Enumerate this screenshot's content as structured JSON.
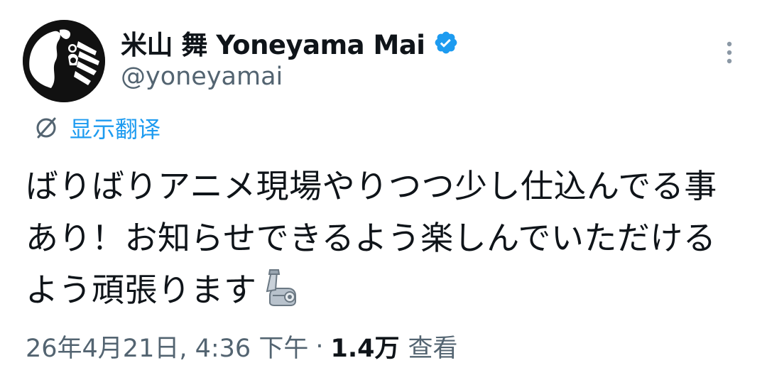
{
  "author": {
    "display_name": "米山 舞 Yoneyama Mai",
    "handle": "@yoneyamai",
    "verified": true,
    "verified_color": "#1d9bf0",
    "avatar_icon": "avatar-illustration"
  },
  "translate": {
    "label": "显示翻译",
    "icon": "translate-icon",
    "color": "#1d9bf0"
  },
  "tweet": {
    "text": "ばりばりアニメ現場やりつつ少し仕込んでる事あり！お知らせできるよう楽しんでいただけるよう頑張ります",
    "emoji": "mechanical-arm-emoji"
  },
  "meta": {
    "timestamp": "26年4月21日, 4:36 下午",
    "separator": "·",
    "views_count": "1.4万",
    "views_label": "查看"
  },
  "actions": {
    "more_icon": "more-vertical-icon"
  }
}
